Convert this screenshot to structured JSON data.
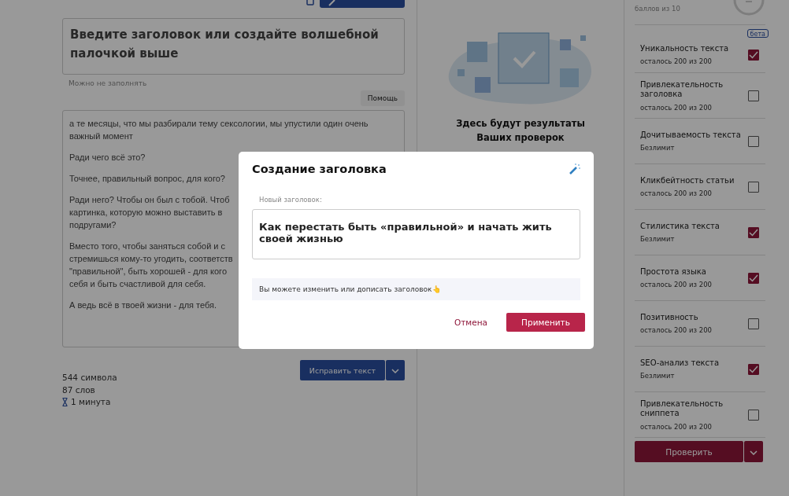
{
  "editor": {
    "title_placeholder": "Введите заголовок или создайте волшебной палочкой выше",
    "title_hint": "Можно не заполнять",
    "help_tooltip": "Помощь",
    "paragraphs": [
      [
        "а те месяцы, что мы разбирали тему сексологии, мы упустили один очень",
        "важный момент"
      ],
      [
        "Ради чего всё это?"
      ],
      [
        "Точнее, правильный вопрос, для кого?"
      ],
      [
        "Ради него? Чтобы он был с тобой. Чтоб",
        "картинка, которую можно выставить в",
        "подругами?"
      ],
      [
        "Вместо того, чтобы заняться собой и с",
        "стремишься кому-то угодить, соответств",
        "\"правильной\", быть хорошей - для кого",
        "себя и быть счастливой для себя."
      ],
      [
        "А ведь всё в твоей жизни - для тебя."
      ]
    ],
    "fix_button": "Исправить текст",
    "stats": [
      {
        "kind": "plain",
        "text": "544 символа"
      },
      {
        "kind": "plain",
        "text": "87 слов"
      },
      {
        "kind": "time",
        "text": "1 минута"
      }
    ]
  },
  "results": {
    "message_lines": [
      "Здесь будут результаты",
      "Ваших проверок"
    ]
  },
  "checks": {
    "score_caption": "баллов из 10",
    "badge": "бета",
    "items": [
      {
        "name": "Уникальность текста",
        "quota": "осталось 200 из 200",
        "checked": true
      },
      {
        "name": "Привлекательность заголовка",
        "quota": "осталось 200 из 200",
        "checked": false
      },
      {
        "name": "Дочитываемость текста",
        "quota": "Безлимит",
        "checked": false
      },
      {
        "name": "Кликбейтность статьи",
        "quota": "осталось 200 из 200",
        "checked": false
      },
      {
        "name": "Стилистика текста",
        "quota": "Безлимит",
        "checked": true
      },
      {
        "name": "Простота языка",
        "quota": "осталось 200 из 200",
        "checked": true
      },
      {
        "name": "Позитивность",
        "quota": "осталось 200 из 200",
        "checked": false
      },
      {
        "name": "SEO-анализ текста",
        "quota": "Безлимит",
        "checked": true
      },
      {
        "name": "Привлекательность сниппета",
        "quota": "осталось 200 из 200",
        "checked": false
      }
    ],
    "check_button": "Проверить"
  },
  "dialog": {
    "title": "Создание заголовка",
    "field_label": "Новый заголовок:",
    "value": "Как перестать быть «правильной» и начать жить своей жизнью",
    "hint": "Вы можете изменить или дописать заголовок👆",
    "cancel": "Отмена",
    "apply": "Применить"
  }
}
